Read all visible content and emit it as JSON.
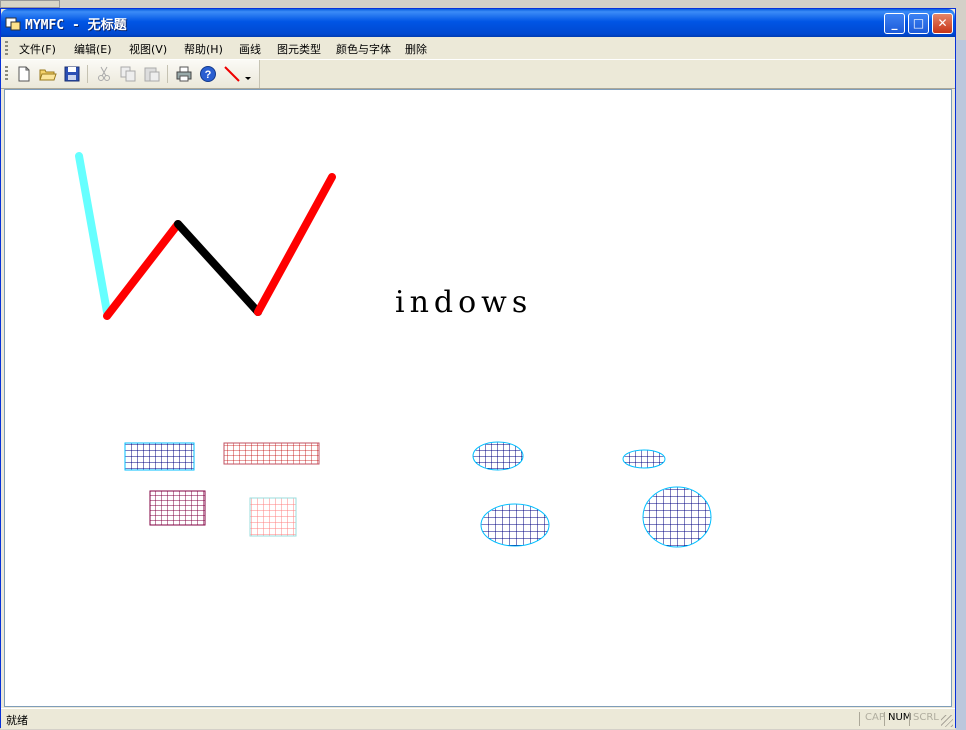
{
  "window": {
    "title": "MYMFC - 无标题",
    "minimize_symbol": "_",
    "maximize_symbol": "□",
    "close_symbol": "✕"
  },
  "menu": [
    {
      "label": "文件(F)"
    },
    {
      "label": "编辑(E)"
    },
    {
      "label": "视图(V)"
    },
    {
      "label": "帮助(H)"
    },
    {
      "label": "画线"
    },
    {
      "label": "图元类型"
    },
    {
      "label": "颜色与字体"
    },
    {
      "label": "删除"
    }
  ],
  "toolbar": [
    {
      "icon": "new-file-icon",
      "enabled": true
    },
    {
      "icon": "open-folder-icon",
      "enabled": true
    },
    {
      "icon": "save-icon",
      "enabled": true
    },
    {
      "icon": "cut-icon",
      "enabled": false
    },
    {
      "icon": "copy-icon",
      "enabled": false
    },
    {
      "icon": "paste-icon",
      "enabled": false
    },
    {
      "icon": "print-icon",
      "enabled": true
    },
    {
      "icon": "help-icon",
      "enabled": true
    },
    {
      "icon": "line-tool-icon",
      "enabled": true
    },
    {
      "icon": "dropdown-arrow-icon",
      "enabled": true
    }
  ],
  "canvas": {
    "text": "indows",
    "colors": {
      "cyan": "#66ffff",
      "red": "#ff0000",
      "black": "#000000",
      "navy": "#000080",
      "maroon": "#800040",
      "pink": "#ff8080"
    }
  },
  "status": {
    "text": "就绪",
    "cap": "CAP",
    "num": "NUM",
    "scrl": "SCRL"
  }
}
